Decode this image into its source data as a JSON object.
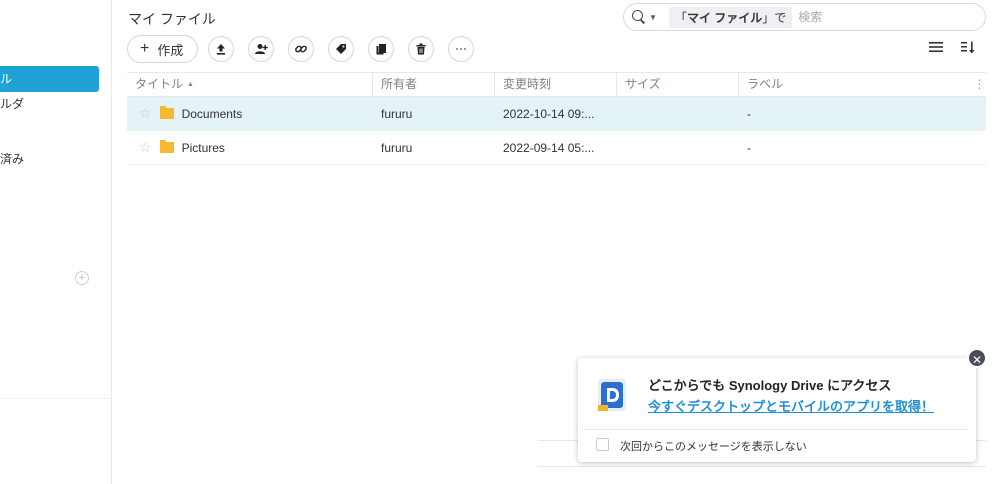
{
  "sidebar": {
    "items": [
      {
        "label": "ル",
        "active": true
      },
      {
        "label": "ルダ",
        "active": false
      },
      {
        "label": "済み",
        "active": false
      }
    ]
  },
  "header": {
    "title": "マイ ファイル"
  },
  "search": {
    "scope_prefix": "「",
    "scope_name": "マイ ファイル",
    "scope_suffix": "」で",
    "placeholder": "検索"
  },
  "toolbar": {
    "create_label": "作成",
    "buttons": [
      "upload-icon",
      "share-user-icon",
      "link-icon",
      "tag-icon",
      "copy-icon",
      "delete-icon",
      "more-icon"
    ]
  },
  "table": {
    "columns": [
      "タイトル",
      "所有者",
      "変更時刻",
      "サイズ",
      "ラベル"
    ],
    "rows": [
      {
        "name": "Documents",
        "owner": "fururu",
        "modified": "2022-10-14 09:...",
        "size": "",
        "label": "-",
        "selected": true
      },
      {
        "name": "Pictures",
        "owner": "fururu",
        "modified": "2022-09-14 05:...",
        "size": "",
        "label": "-",
        "selected": false
      }
    ]
  },
  "popup": {
    "heading": "どこからでも Synology Drive にアクセス",
    "link": "今すぐデスクトップとモバイルのアプリを取得！",
    "checkbox_label": "次回からこのメッセージを表示しない"
  },
  "colors": {
    "accent": "#1fa3d6",
    "selected_row": "#e3f3f8",
    "folder": "#f5b82e",
    "link": "#1f8fd6"
  }
}
